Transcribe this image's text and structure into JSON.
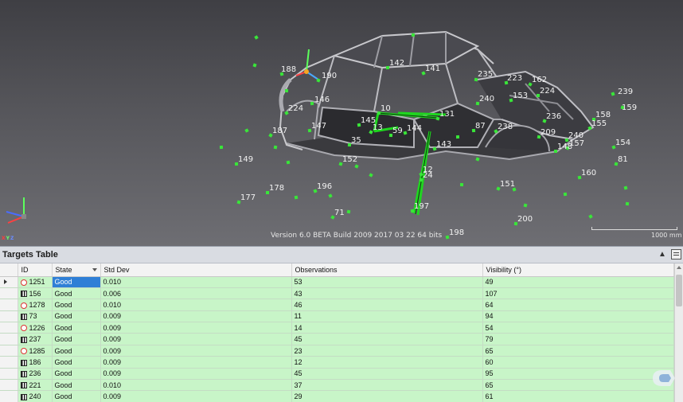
{
  "viewport": {
    "version_text": "Version 6.0 BETA Build 2009 2017 03 22 64 bits",
    "scale_label": "1000 mm",
    "axis_letters": {
      "x": "X",
      "y": "Y",
      "z": "Z"
    },
    "target_labels": [
      "188",
      "190",
      "142",
      "141",
      "235",
      "223",
      "162",
      "224",
      "239",
      "159",
      "146",
      "224",
      "240",
      "153",
      "236",
      "158",
      "155",
      "10",
      "145",
      "13",
      "59",
      "144",
      "131",
      "87",
      "238",
      "209",
      "240",
      "157",
      "148",
      "154",
      "81",
      "147",
      "187",
      "35",
      "143",
      "152",
      "149",
      "12",
      "24",
      "160",
      "151",
      "178",
      "196",
      "177",
      "197",
      "71",
      "200",
      "198"
    ],
    "colors": {
      "target": "#39e639",
      "selected_rays": "#1fd61f",
      "background_top": "#3f3f44",
      "background_bottom": "#6e6e73"
    }
  },
  "panel": {
    "title": "Targets Table",
    "collapse_icon": "chevron-up-icon",
    "menu_icon": "panel-menu-icon"
  },
  "table": {
    "columns": [
      "ID",
      "State",
      "Std Dev",
      "Observations",
      "Visibility (°)"
    ],
    "rows": [
      {
        "icon": "circle-target-icon",
        "id": "1251",
        "state": "Good",
        "std_dev": "0.010",
        "observations": "53",
        "visibility": "49",
        "current": true
      },
      {
        "icon": "coded-target-icon",
        "id": "156",
        "state": "Good",
        "std_dev": "0.006",
        "observations": "43",
        "visibility": "107"
      },
      {
        "icon": "circle-target-icon",
        "id": "1278",
        "state": "Good",
        "std_dev": "0.010",
        "observations": "46",
        "visibility": "64"
      },
      {
        "icon": "coded-target-icon",
        "id": "73",
        "state": "Good",
        "std_dev": "0.009",
        "observations": "11",
        "visibility": "94"
      },
      {
        "icon": "circle-target-icon",
        "id": "1226",
        "state": "Good",
        "std_dev": "0.009",
        "observations": "14",
        "visibility": "54"
      },
      {
        "icon": "coded-target-icon",
        "id": "237",
        "state": "Good",
        "std_dev": "0.009",
        "observations": "45",
        "visibility": "79"
      },
      {
        "icon": "circle-target-icon",
        "id": "1285",
        "state": "Good",
        "std_dev": "0.009",
        "observations": "23",
        "visibility": "65"
      },
      {
        "icon": "coded-target-icon",
        "id": "186",
        "state": "Good",
        "std_dev": "0.009",
        "observations": "12",
        "visibility": "60"
      },
      {
        "icon": "coded-target-icon",
        "id": "236",
        "state": "Good",
        "std_dev": "0.009",
        "observations": "45",
        "visibility": "95"
      },
      {
        "icon": "coded-target-icon",
        "id": "221",
        "state": "Good",
        "std_dev": "0.010",
        "observations": "37",
        "visibility": "65"
      },
      {
        "icon": "coded-target-icon",
        "id": "240",
        "state": "Good",
        "std_dev": "0.009",
        "observations": "29",
        "visibility": "61"
      }
    ]
  },
  "branding": {
    "logo_icon": "app-logo-icon"
  }
}
